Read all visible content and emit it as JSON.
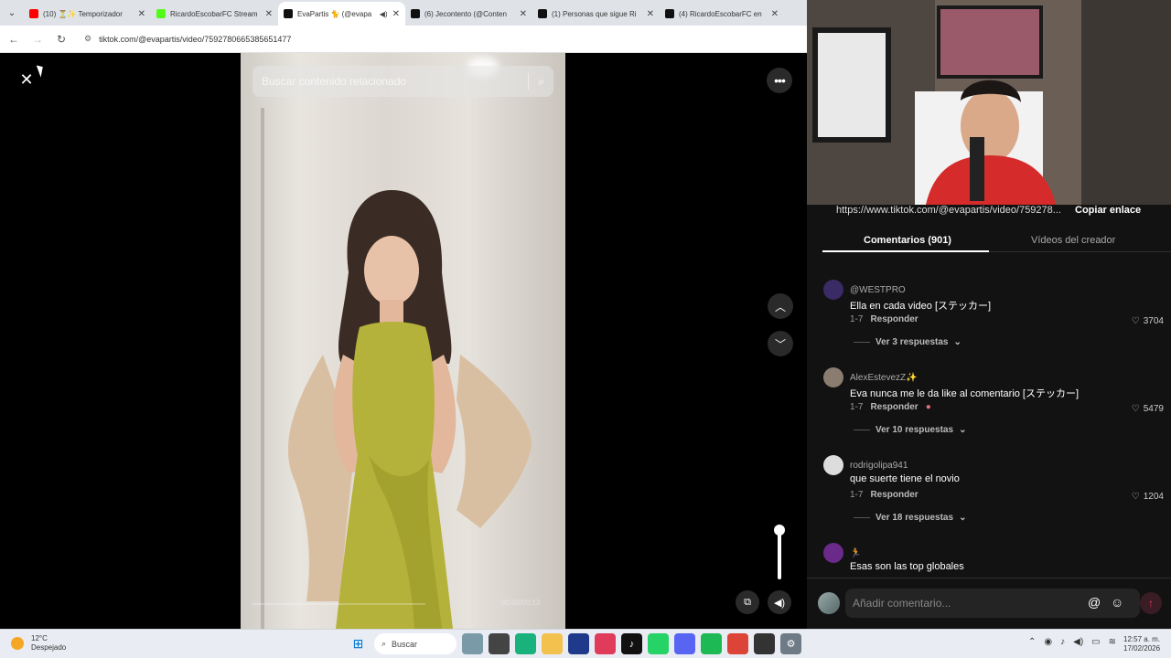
{
  "browser": {
    "tabs": [
      {
        "title": "(10) ⏳✨ Temporizador",
        "favicon_color": "#ff0000",
        "active": false
      },
      {
        "title": "RicardoEscobarFC Stream",
        "favicon_color": "#53fc18",
        "active": false
      },
      {
        "title": "EvaPartis 🐈 (@evapa",
        "favicon_color": "#111111",
        "active": true
      },
      {
        "title": "(6) Jecontento (@Conten",
        "favicon_color": "#111111",
        "active": false
      },
      {
        "title": "(1) Personas que sigue Ri",
        "favicon_color": "#111111",
        "active": false
      },
      {
        "title": "(4) RicardoEscobarFC en",
        "favicon_color": "#111111",
        "active": false
      }
    ],
    "url": "tiktok.com/@evapartis/video/7592780665385651477"
  },
  "viewer": {
    "search_placeholder": "Buscar contenido relacionado",
    "time": "00:00/00:13"
  },
  "panel": {
    "link": "https://www.tiktok.com/@evapartis/video/759278...",
    "copy_link": "Copiar enlace",
    "tabs": {
      "comments": "Comentarios (901)",
      "creator_videos": "Vídeos del creador"
    },
    "comments": [
      {
        "user": "@WESTPRO",
        "text": "Ella en cada video [ステッカー]",
        "date": "1-7",
        "reply": "Responder",
        "likes": "3704",
        "replies": "Ver 3 respuestas",
        "avatar_color": "#3a2a66"
      },
      {
        "user": "AlexEstevezZ✨",
        "text": "Eva nunca me le da like al comentario [ステッカー]",
        "date": "1-7",
        "reply": "Responder",
        "likes": "5479",
        "replies": "Ver 10 respuestas",
        "avatar_color": "#8a7d70"
      },
      {
        "user": "rodrigolipa941",
        "text": "que suerte tiene el novio",
        "date": "1-7",
        "reply": "Responder",
        "likes": "1204",
        "replies": "Ver 18 respuestas",
        "avatar_color": "#dddddd"
      },
      {
        "user": "🏃",
        "text": "Esas son las top globales",
        "date": "",
        "reply": "",
        "likes": "",
        "replies": "",
        "avatar_color": "#6a2a8a"
      }
    ],
    "input_placeholder": "Añadir comentario..."
  },
  "taskbar": {
    "temperature": "12°C",
    "weather": "Despejado",
    "search": "Buscar",
    "time": "12:57 a. m.",
    "date": "17/02/2026"
  }
}
